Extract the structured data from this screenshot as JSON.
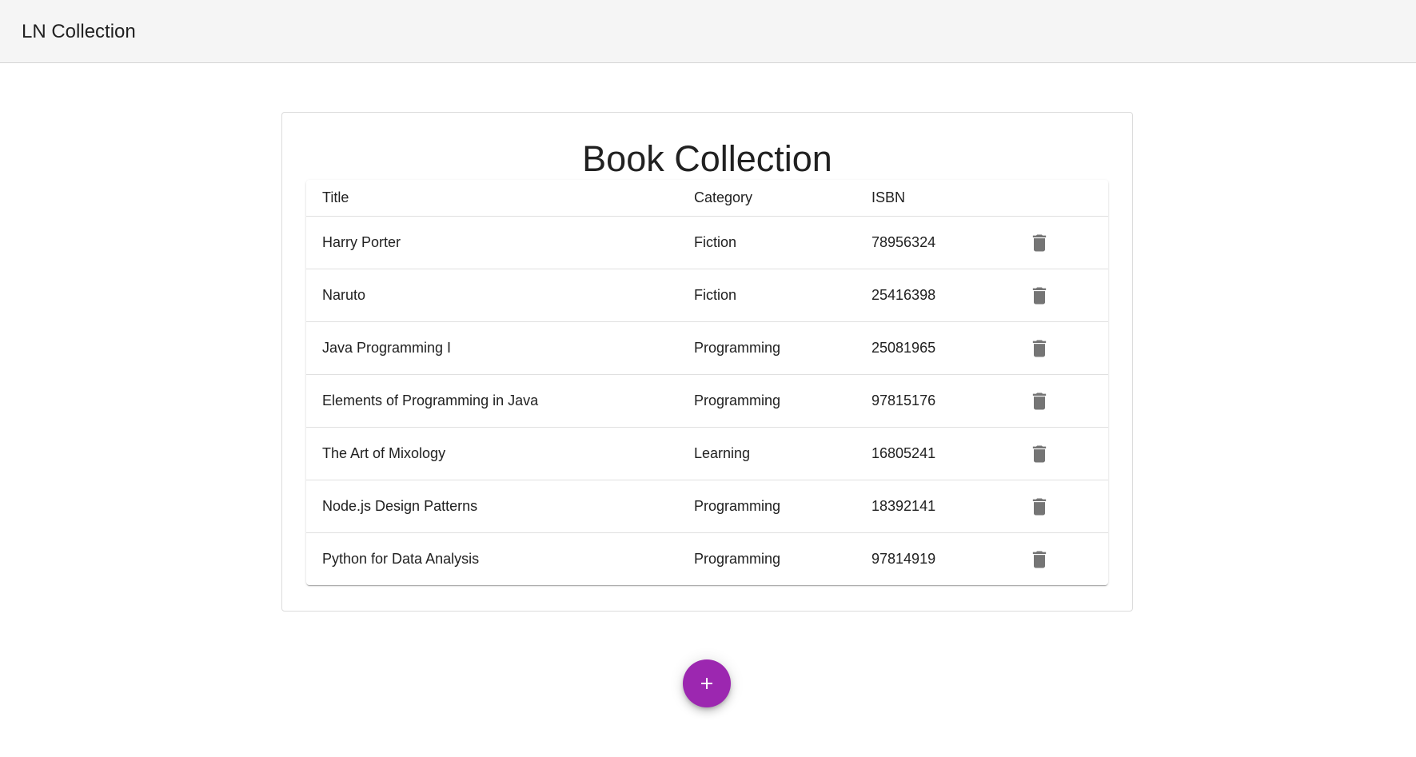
{
  "app": {
    "title": "LN Collection"
  },
  "card": {
    "title": "Book Collection"
  },
  "table": {
    "columns": [
      "Title",
      "Category",
      "ISBN"
    ],
    "rows": [
      {
        "title": "Harry Porter",
        "category": "Fiction",
        "isbn": "78956324"
      },
      {
        "title": "Naruto",
        "category": "Fiction",
        "isbn": "25416398"
      },
      {
        "title": "Java Programming I",
        "category": "Programming",
        "isbn": "25081965"
      },
      {
        "title": "Elements of Programming in Java",
        "category": "Programming",
        "isbn": "97815176"
      },
      {
        "title": "The Art of Mixology",
        "category": "Learning",
        "isbn": "16805241"
      },
      {
        "title": "Node.js Design Patterns",
        "category": "Programming",
        "isbn": "18392141"
      },
      {
        "title": "Python for Data Analysis",
        "category": "Programming",
        "isbn": "97814919"
      }
    ],
    "row_action_icon": "delete-icon"
  },
  "fab": {
    "icon": "plus-icon"
  },
  "colors": {
    "toolbar_bg": "#f5f5f5",
    "accent": "#9c27b0",
    "icon": "#757575"
  }
}
